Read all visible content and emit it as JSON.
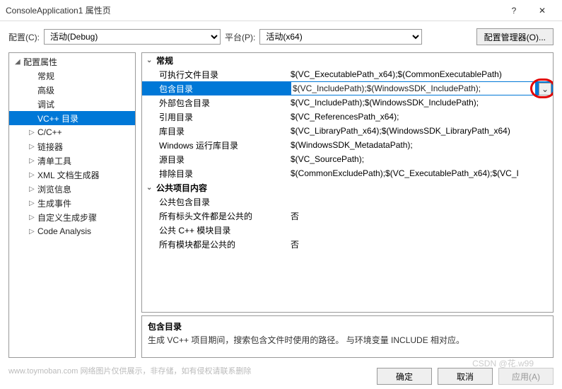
{
  "titlebar": {
    "title": "ConsoleApplication1 属性页",
    "help": "?",
    "close": "✕"
  },
  "toolbar": {
    "config_label": "配置(C):",
    "config_value": "活动(Debug)",
    "platform_label": "平台(P):",
    "platform_value": "活动(x64)",
    "manager_label": "配置管理器(O)..."
  },
  "tree": {
    "root": "配置属性",
    "items": [
      {
        "label": "常规",
        "expandable": false
      },
      {
        "label": "高级",
        "expandable": false
      },
      {
        "label": "调试",
        "expandable": false
      },
      {
        "label": "VC++ 目录",
        "expandable": false,
        "selected": true
      },
      {
        "label": "C/C++",
        "expandable": true
      },
      {
        "label": "链接器",
        "expandable": true
      },
      {
        "label": "清单工具",
        "expandable": true
      },
      {
        "label": "XML 文档生成器",
        "expandable": true
      },
      {
        "label": "浏览信息",
        "expandable": true
      },
      {
        "label": "生成事件",
        "expandable": true
      },
      {
        "label": "自定义生成步骤",
        "expandable": true
      },
      {
        "label": "Code Analysis",
        "expandable": true
      }
    ]
  },
  "grid": {
    "groups": [
      {
        "name": "常规",
        "rows": [
          {
            "label": "可执行文件目录",
            "value": "$(VC_ExecutablePath_x64);$(CommonExecutablePath)"
          },
          {
            "label": "包含目录",
            "value": "$(VC_IncludePath);$(WindowsSDK_IncludePath);",
            "selected": true
          },
          {
            "label": "外部包含目录",
            "value": "$(VC_IncludePath);$(WindowsSDK_IncludePath);"
          },
          {
            "label": "引用目录",
            "value": "$(VC_ReferencesPath_x64);"
          },
          {
            "label": "库目录",
            "value": "$(VC_LibraryPath_x64);$(WindowsSDK_LibraryPath_x64)"
          },
          {
            "label": "Windows 运行库目录",
            "value": "$(WindowsSDK_MetadataPath);"
          },
          {
            "label": "源目录",
            "value": "$(VC_SourcePath);"
          },
          {
            "label": "排除目录",
            "value": "$(CommonExcludePath);$(VC_ExecutablePath_x64);$(VC_I"
          }
        ]
      },
      {
        "name": "公共项目内容",
        "rows": [
          {
            "label": "公共包含目录",
            "value": ""
          },
          {
            "label": "所有标头文件都是公共的",
            "value": "否"
          },
          {
            "label": "公共 C++ 模块目录",
            "value": ""
          },
          {
            "label": "所有模块都是公共的",
            "value": "否"
          }
        ]
      }
    ]
  },
  "description": {
    "title": "包含目录",
    "text": "生成 VC++ 项目期间，搜索包含文件时使用的路径。  与环境变量 INCLUDE 相对应。"
  },
  "footer": {
    "ok": "确定",
    "cancel": "取消",
    "apply": "应用(A)"
  },
  "watermark": "www.toymoban.com  网络图片仅供展示，非存储，如有侵权请联系删除",
  "watermark2": "CSDN @花.w99"
}
